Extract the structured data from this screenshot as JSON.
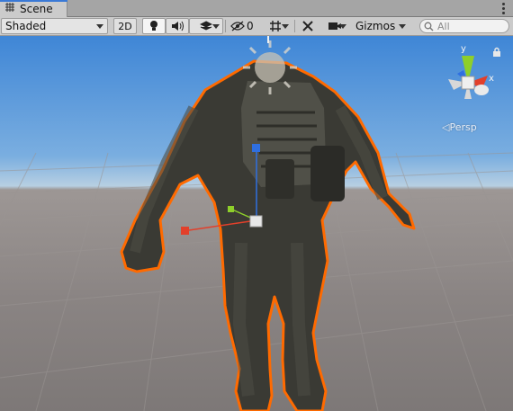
{
  "tab": {
    "title": "Scene"
  },
  "toolbar": {
    "shading_mode": "Shaded",
    "mode_2d_label": "2D",
    "hidden_count": "0",
    "gizmos_label": "Gizmos",
    "search_placeholder": "All"
  },
  "viewport": {
    "projection_label": "Persp"
  },
  "icons": {
    "tab": "scene-grid-icon",
    "menu": "kebab-menu-icon",
    "lighting": "lightbulb-icon",
    "audio": "speaker-icon",
    "effects": "effects-layers-icon",
    "visibility": "eye-slash-icon",
    "grid": "grid-hash-icon",
    "tools": "tools-icon",
    "camera": "camera-icon",
    "search": "search-icon",
    "lock": "lock-icon"
  },
  "colors": {
    "selection_outline": "#ff6a00",
    "x_axis": "#e2402b",
    "y_axis": "#8ecf2a",
    "z_axis": "#2f6fe0",
    "tab_accent": "#3a79d6"
  }
}
